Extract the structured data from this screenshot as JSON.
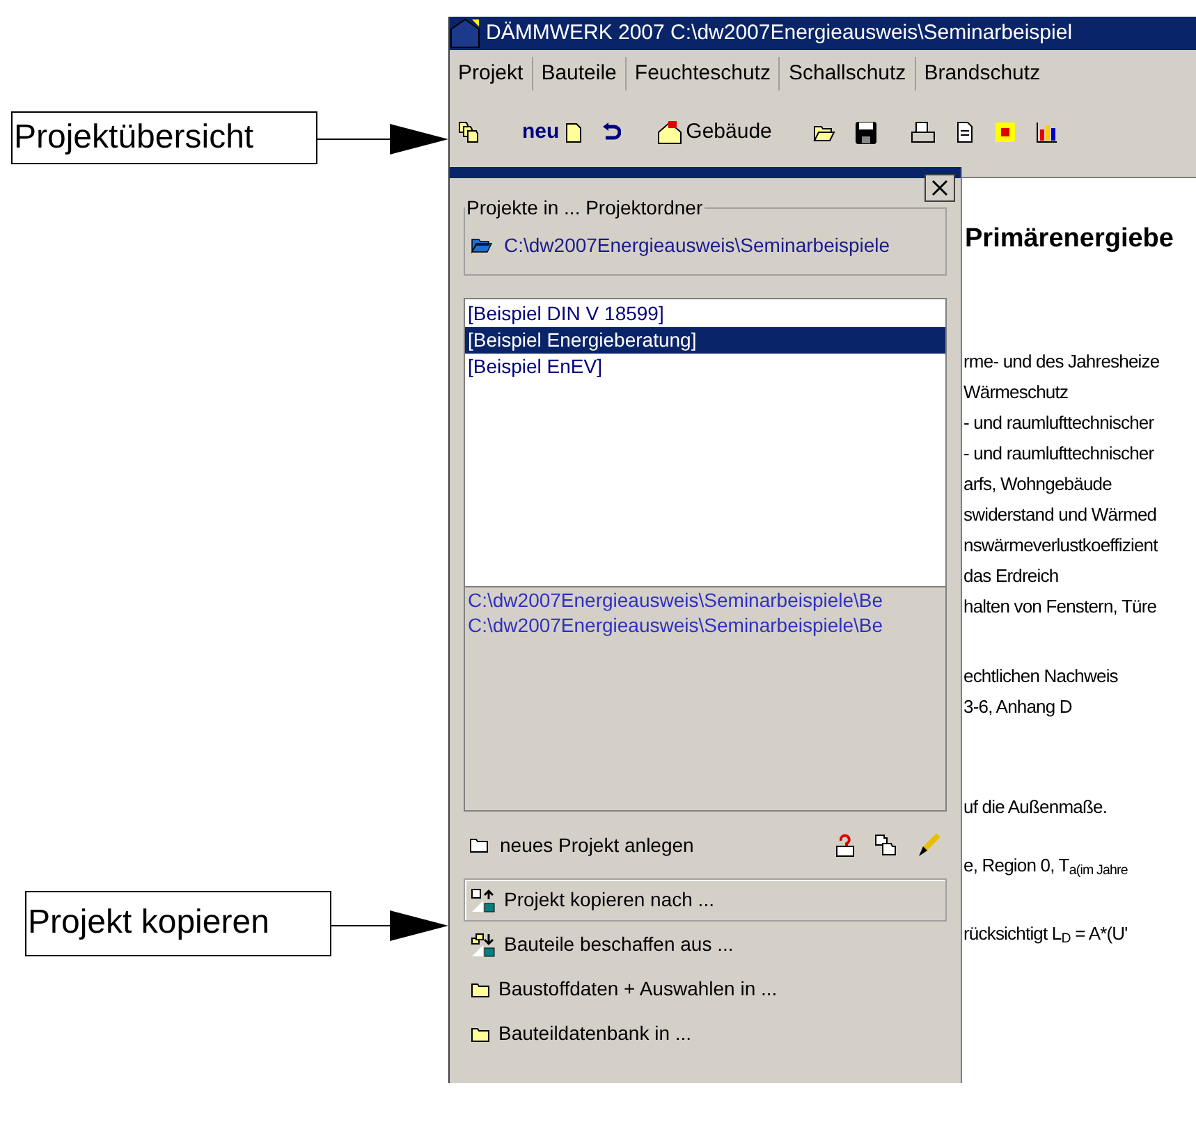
{
  "annotations": [
    {
      "label": "Projektübersicht"
    },
    {
      "label": "Projekt kopieren"
    }
  ],
  "window": {
    "title": "DÄMMWERK 2007  C:\\dw2007Energieausweis\\Seminarbeispiel"
  },
  "menu": [
    {
      "label": "Projekt"
    },
    {
      "label": "Bauteile"
    },
    {
      "label": "Feuchteschutz"
    },
    {
      "label": "Schallschutz"
    },
    {
      "label": "Brandschutz"
    }
  ],
  "toolbar": {
    "new_label": "neu",
    "building_label": "Gebäude"
  },
  "panel": {
    "group_title": "Projekte in ... Projektordner",
    "folder_path": "C:\\dw2007Energieausweis\\Seminarbeispiele",
    "projects": [
      {
        "name": "[Beispiel DIN V 18599]",
        "selected": false
      },
      {
        "name": "[Beispiel Energieberatung]",
        "selected": true
      },
      {
        "name": "[Beispiel EnEV]",
        "selected": false
      }
    ],
    "paths": [
      "C:\\dw2007Energieausweis\\Seminarbeispiele\\Be",
      "C:\\dw2007Energieausweis\\Seminarbeispiele\\Be"
    ],
    "new_project": "neues Projekt anlegen",
    "actions": [
      {
        "label": "Projekt kopieren nach ...",
        "kind": "copy",
        "selected": true
      },
      {
        "label": "Bauteile beschaffen aus ...",
        "kind": "fetch",
        "selected": false
      },
      {
        "label": "Baustoffdaten + Auswahlen in ...",
        "kind": "folder",
        "selected": false
      },
      {
        "label": "Bauteildatenbank in ...",
        "kind": "folder",
        "selected": false
      }
    ]
  },
  "document": {
    "heading": "Primärenergiebe",
    "paragraphs": [
      {
        "lines": [
          "rme- und des Jahresheize",
          "Wärmeschutz",
          "- und raumlufttechnischer",
          "- und raumlufttechnischer",
          "arfs, Wohngebäude",
          "swiderstand und Wärmed",
          "nswärmeverlustkoeffizient",
          "das Erdreich",
          "halten von Fenstern, Türe"
        ]
      },
      {
        "lines": [
          "echtlichen Nachweis",
          "3-6, Anhang D"
        ]
      },
      {
        "lines": [
          "uf die Außenmaße."
        ]
      },
      {
        "lines": [
          "e, Region 0, T$_{a(im Jahre}$"
        ]
      },
      {
        "lines": [
          "rücksichtigt L$_{D}$ = A*(U'"
        ]
      }
    ]
  }
}
